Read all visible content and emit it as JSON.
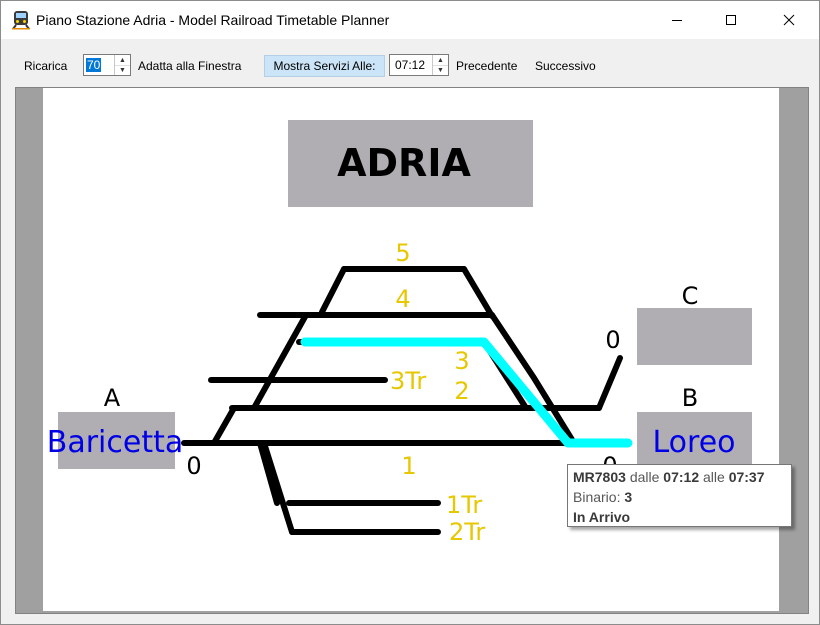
{
  "window": {
    "title": "Piano Stazione Adria - Model Railroad Timetable Planner",
    "minimize_glyph": "—",
    "maximize_glyph": "☐",
    "close_glyph": "✕"
  },
  "toolbar": {
    "reload_label": "Ricarica",
    "zoom_value": "70",
    "fit_label": "Adatta alla Finestra",
    "show_services_label": "Mostra Servizi Alle:",
    "time_value": "07:12",
    "previous_label": "Precedente",
    "next_label": "Successivo"
  },
  "station": {
    "name": "ADRIA",
    "exits": [
      {
        "letter": "A",
        "name": "Baricetta",
        "platform_label": "0"
      },
      {
        "letter": "B",
        "name": "Loreo",
        "platform_label": "0"
      },
      {
        "letter": "C",
        "name": "",
        "platform_label": "0"
      }
    ],
    "tracks": [
      {
        "label": "5"
      },
      {
        "label": "4"
      },
      {
        "label": "3"
      },
      {
        "label": "3Tr"
      },
      {
        "label": "2"
      },
      {
        "label": "1"
      },
      {
        "label": "1Tr"
      },
      {
        "label": "2Tr"
      }
    ]
  },
  "tooltip": {
    "train": "MR7803",
    "from_word": "dalle",
    "from_time": "07:12",
    "to_word": "alle",
    "to_time": "07:37",
    "platform_word": "Binario:",
    "platform": "3",
    "status": "In Arrivo"
  },
  "colors": {
    "track": "#000000",
    "highlight_route": "#00ffff",
    "track_label": "#e6c700",
    "station_name_label": "#0000e6",
    "box_fill": "#b0aeb2"
  }
}
